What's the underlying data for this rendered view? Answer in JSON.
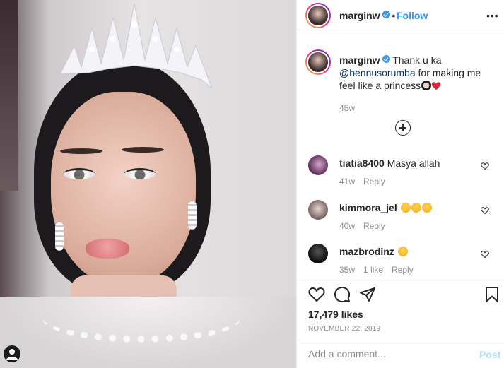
{
  "header": {
    "username": "marginw",
    "dot": "•",
    "follow_label": "Follow",
    "more_label": "•••"
  },
  "caption": {
    "username": "marginw",
    "text_before": "Thank u ka",
    "mention": "@bennusorumba",
    "text_after": "for making me feel like a princess",
    "age": "45w"
  },
  "comments": [
    {
      "username": "tiatia8400",
      "text": "Masya allah",
      "age": "41w",
      "likes": "",
      "reply": "Reply"
    },
    {
      "username": "kimmora_jel",
      "text": "",
      "emojis": [
        "heart-eyes-icon",
        "heart-eyes-icon",
        "heart-eyes-icon"
      ],
      "age": "40w",
      "likes": "",
      "reply": "Reply"
    },
    {
      "username": "mazbrodinz",
      "text": "",
      "emojis": [
        "kiss-face-icon"
      ],
      "age": "35w",
      "likes": "1 like",
      "reply": "Reply"
    }
  ],
  "stats": {
    "likes": "17,479 likes",
    "date": "NOVEMBER 22, 2019"
  },
  "add_comment": {
    "placeholder": "Add a comment...",
    "post_label": "Post"
  },
  "colors": {
    "accent": "#3897f0",
    "post_disabled": "#b2dffc",
    "meta": "#8e8e8e",
    "heart": "#ed4956"
  }
}
